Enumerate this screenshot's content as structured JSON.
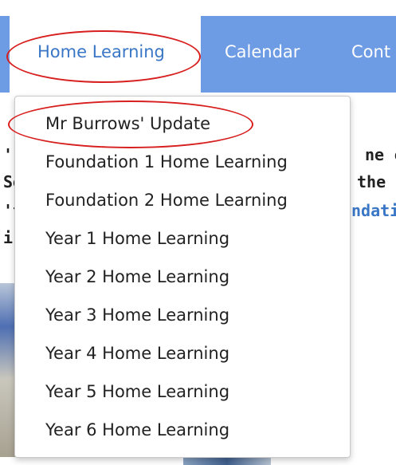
{
  "nav": {
    "items": [
      "Home Learning",
      "Calendar",
      "Cont"
    ],
    "active_index": 0,
    "bar_color": "#6d9be4",
    "active_text_color": "#3a76c6"
  },
  "dropdown": {
    "items": [
      "Mr Burrows' Update",
      "Foundation 1 Home Learning",
      "Foundation 2 Home Learning",
      "Year 1 Home Learning",
      "Year 2 Home Learning",
      "Year 3 Home Learning",
      "Year 4 Home Learning",
      "Year 5 Home Learning",
      "Year 6 Home Learning"
    ]
  },
  "background": {
    "right_fragments": [
      "ne c",
      "the",
      "ndati"
    ],
    "left_fragments": [
      "'",
      "Se",
      "'t",
      "i"
    ]
  },
  "annotations": {
    "ring_color": "#d81f1f",
    "circled": [
      "Home Learning",
      "Mr Burrows' Update"
    ]
  }
}
